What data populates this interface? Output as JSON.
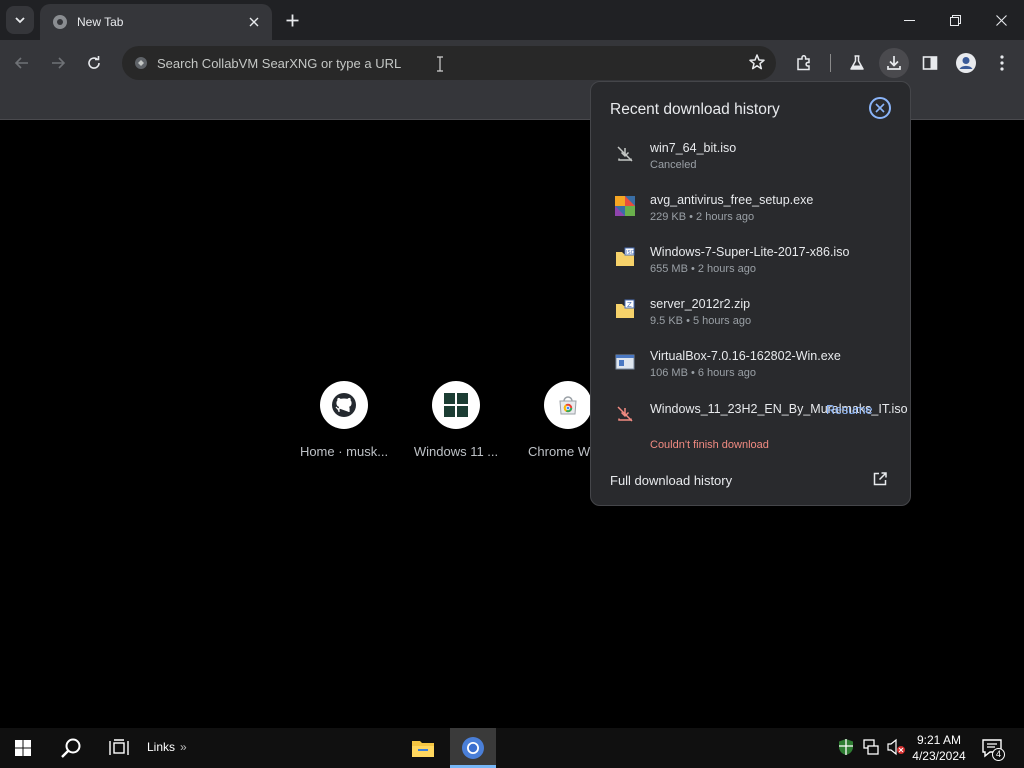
{
  "browser": {
    "tab": {
      "title": "New Tab",
      "close_icon": "close-icon",
      "favicon": "chrome-page-icon"
    },
    "new_tab_icon": "plus-icon",
    "tab_search_icon": "chevron-down-icon",
    "window_controls": [
      "minimize-icon",
      "restore-icon",
      "close-icon"
    ],
    "omnibox": {
      "placeholder": "Search CollabVM SearXNG or type a URL",
      "icon": "search-engine-icon"
    },
    "toolbar_icons": [
      "back-icon",
      "forward-icon",
      "reload-icon",
      "star-icon",
      "extensions-icon",
      "labs-flask-icon",
      "download-icon",
      "side-panel-icon",
      "profile-icon",
      "menu-icon"
    ]
  },
  "shortcuts": [
    {
      "label": "Home · musk...",
      "icon": "github-icon"
    },
    {
      "label": "Windows 11 ...",
      "icon": "windows-icon"
    },
    {
      "label": "Chrome We...",
      "icon": "chrome-web-store-icon"
    }
  ],
  "downloads": {
    "title": "Recent download history",
    "items": [
      {
        "name": "win7_64_bit.iso",
        "status": "Canceled",
        "icon": "download-canceled-icon"
      },
      {
        "name": "avg_antivirus_free_setup.exe",
        "status": "229 KB • 2 hours ago",
        "icon": "avg-installer-icon"
      },
      {
        "name": "Windows-7-Super-Lite-2017-x86.iso",
        "status": "655 MB • 2 hours ago",
        "icon": "iso-file-icon"
      },
      {
        "name": "server_2012r2.zip",
        "status": "9.5 KB • 5 hours ago",
        "icon": "zip-file-icon"
      },
      {
        "name": "VirtualBox-7.0.16-162802-Win.exe",
        "status": "106 MB • 6 hours ago",
        "icon": "installer-file-icon"
      },
      {
        "name": "Windows_11_23H2_EN_By_Muralmaks_IT.iso",
        "status": "Couldn't finish download",
        "icon": "download-failed-icon",
        "action": "Resume"
      }
    ],
    "footer": "Full download history",
    "footer_icon": "open-external-icon",
    "accent": "#8ab4f8",
    "error_color": "#f28b82"
  },
  "taskbar": {
    "links_label": "Links",
    "clock_time": "9:21 AM",
    "clock_date": "4/23/2024",
    "notification_count": "4",
    "icons": [
      "start-windows-icon",
      "search-icon",
      "task-view-icon",
      "file-explorer-icon",
      "chrome-icon",
      "security-shield-icon",
      "network-icon",
      "volume-muted-icon",
      "action-center-icon"
    ]
  }
}
